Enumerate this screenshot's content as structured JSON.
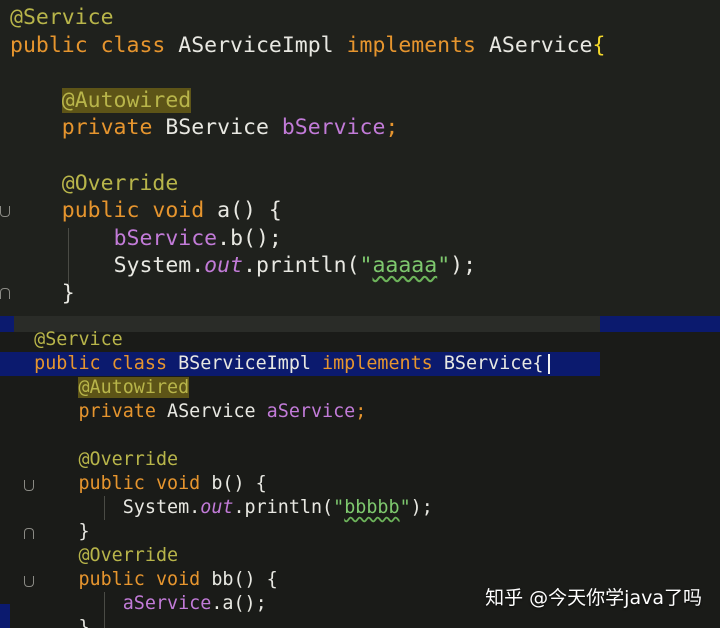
{
  "panel_a": {
    "lines": [
      {
        "parts": [
          {
            "t": "@Service",
            "c": "ann"
          }
        ]
      },
      {
        "parts": [
          {
            "t": "public class ",
            "c": "kw"
          },
          {
            "t": "AServiceImpl ",
            "c": "type"
          },
          {
            "t": "implements ",
            "c": "kw"
          },
          {
            "t": "AService",
            "c": "type"
          },
          {
            "t": "{",
            "c": "brace-hl"
          }
        ]
      },
      {
        "parts": []
      },
      {
        "parts": [
          {
            "t": "    "
          },
          {
            "t": "@Autowired",
            "c": "ann ann-hl"
          }
        ]
      },
      {
        "parts": [
          {
            "t": "    "
          },
          {
            "t": "private ",
            "c": "kw"
          },
          {
            "t": "BService ",
            "c": "type"
          },
          {
            "t": "bService",
            "c": "fld"
          },
          {
            "t": ";",
            "c": "kw"
          }
        ]
      },
      {
        "parts": []
      },
      {
        "parts": [
          {
            "t": "    "
          },
          {
            "t": "@Override",
            "c": "ann"
          }
        ]
      },
      {
        "parts": [
          {
            "t": "    "
          },
          {
            "t": "public void ",
            "c": "kw"
          },
          {
            "t": "a",
            "c": "type"
          },
          {
            "t": "() {",
            "c": "plain"
          }
        ]
      },
      {
        "parts": [
          {
            "t": "        "
          },
          {
            "t": "bService",
            "c": "fld"
          },
          {
            "t": ".b();",
            "c": "plain"
          }
        ]
      },
      {
        "parts": [
          {
            "t": "        "
          },
          {
            "t": "System.",
            "c": "plain"
          },
          {
            "t": "out",
            "c": "ital"
          },
          {
            "t": ".println(",
            "c": "plain"
          },
          {
            "t": "\"",
            "c": "str"
          },
          {
            "t": "aaaaa",
            "c": "str str-q"
          },
          {
            "t": "\"",
            "c": "str"
          },
          {
            "t": ");",
            "c": "plain"
          }
        ]
      },
      {
        "parts": [
          {
            "t": "    "
          },
          {
            "t": "}",
            "c": "plain"
          }
        ]
      }
    ]
  },
  "panel_b": {
    "lines": [
      {
        "parts": [
          {
            "t": "  "
          },
          {
            "t": "@Service",
            "c": "ann"
          }
        ]
      },
      {
        "parts": [
          {
            "t": "  "
          },
          {
            "t": "public class ",
            "c": "kw"
          },
          {
            "t": "BServiceImpl ",
            "c": "type"
          },
          {
            "t": "implements ",
            "c": "kw"
          },
          {
            "t": "BService",
            "c": "type"
          },
          {
            "t": "{",
            "c": "plain"
          }
        ]
      },
      {
        "parts": [
          {
            "t": "      "
          },
          {
            "t": "@Autowired",
            "c": "ann ann-hl"
          }
        ]
      },
      {
        "parts": [
          {
            "t": "      "
          },
          {
            "t": "private ",
            "c": "kw"
          },
          {
            "t": "AService ",
            "c": "type"
          },
          {
            "t": "aService",
            "c": "fld"
          },
          {
            "t": ";",
            "c": "kw"
          }
        ]
      },
      {
        "parts": []
      },
      {
        "parts": [
          {
            "t": "      "
          },
          {
            "t": "@Override",
            "c": "ann"
          }
        ]
      },
      {
        "parts": [
          {
            "t": "      "
          },
          {
            "t": "public void ",
            "c": "kw"
          },
          {
            "t": "b",
            "c": "type"
          },
          {
            "t": "() {",
            "c": "plain"
          }
        ]
      },
      {
        "parts": [
          {
            "t": "          "
          },
          {
            "t": "System.",
            "c": "plain"
          },
          {
            "t": "out",
            "c": "ital"
          },
          {
            "t": ".println(",
            "c": "plain"
          },
          {
            "t": "\"",
            "c": "str"
          },
          {
            "t": "bbbbb",
            "c": "str str-q"
          },
          {
            "t": "\"",
            "c": "str"
          },
          {
            "t": ");",
            "c": "plain"
          }
        ]
      },
      {
        "parts": [
          {
            "t": "      "
          },
          {
            "t": "}",
            "c": "plain"
          }
        ]
      },
      {
        "parts": [
          {
            "t": "      "
          },
          {
            "t": "@Override",
            "c": "ann"
          }
        ]
      },
      {
        "parts": [
          {
            "t": "      "
          },
          {
            "t": "public void ",
            "c": "kw"
          },
          {
            "t": "bb",
            "c": "type"
          },
          {
            "t": "() {",
            "c": "plain"
          }
        ]
      },
      {
        "parts": [
          {
            "t": "          "
          },
          {
            "t": "aService",
            "c": "fld"
          },
          {
            "t": ".a();",
            "c": "plain"
          }
        ]
      },
      {
        "parts": [
          {
            "t": "      "
          },
          {
            "t": "}",
            "c": "plain"
          }
        ]
      }
    ]
  },
  "watermark": "知乎 @今天你学java了吗"
}
